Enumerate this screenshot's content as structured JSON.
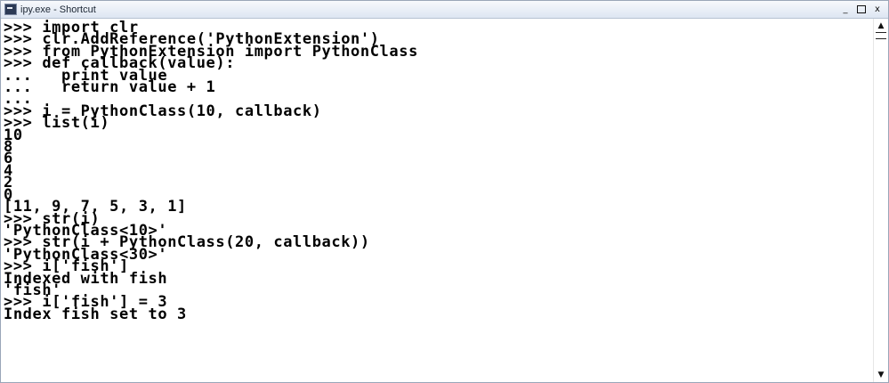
{
  "window": {
    "title": "ipy.exe - Shortcut",
    "icon": "console-app-icon",
    "controls": {
      "minimize": "_",
      "maximize": "□",
      "close": "x"
    }
  },
  "console": {
    "lines": [
      ">>> import clr",
      ">>> clr.AddReference('PythonExtension')",
      ">>> from PythonExtension import PythonClass",
      ">>> def callback(value):",
      "...   print value",
      "...   return value + 1",
      "...",
      ">>> i = PythonClass(10, callback)",
      ">>> list(i)",
      "10",
      "8",
      "6",
      "4",
      "2",
      "0",
      "[11, 9, 7, 5, 3, 1]",
      ">>> str(i)",
      "'PythonClass<10>'",
      ">>> str(i + PythonClass(20, callback))",
      "'PythonClass<30>'",
      ">>> i['fish']",
      "Indexed with fish",
      "'fish'",
      ">>> i['fish'] = 3",
      "Index fish set to 3"
    ]
  },
  "scrollbar": {
    "up": "▲",
    "down": "▼"
  }
}
